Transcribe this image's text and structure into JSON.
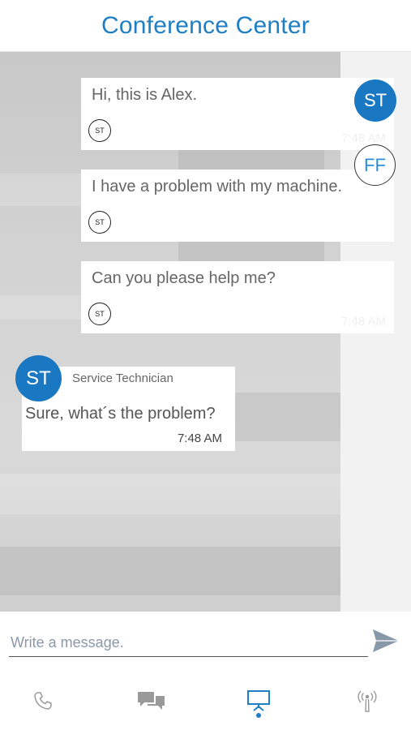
{
  "header": {
    "title": "Conference Center"
  },
  "messages_out": [
    {
      "text": "Hi, this is Alex.",
      "avatar": "ST",
      "time": "7:48 AM"
    },
    {
      "text": "I have a problem with my machine.",
      "avatar": "ST",
      "time": ""
    },
    {
      "text": "Can you please help me?",
      "avatar": "ST",
      "time": "7:48 AM"
    }
  ],
  "participants": [
    {
      "initials": "ST",
      "color": "#1a78c2"
    },
    {
      "initials": "FF",
      "color": "#2b8fd8"
    }
  ],
  "message_in": {
    "avatar": "ST",
    "sender": "Service Technician",
    "text": "Sure, what´s the problem?",
    "time": "7:48 AM"
  },
  "composer": {
    "placeholder": "Write a message.",
    "value": ""
  },
  "tabs": [
    {
      "name": "phone",
      "icon": "phone-icon"
    },
    {
      "name": "chat",
      "icon": "chat-icon"
    },
    {
      "name": "presentation",
      "icon": "presentation-icon",
      "active": true
    },
    {
      "name": "broadcast",
      "icon": "broadcast-icon"
    }
  ],
  "colors": {
    "accent": "#1f7fc4",
    "avatar_blue": "#1a78c2"
  }
}
